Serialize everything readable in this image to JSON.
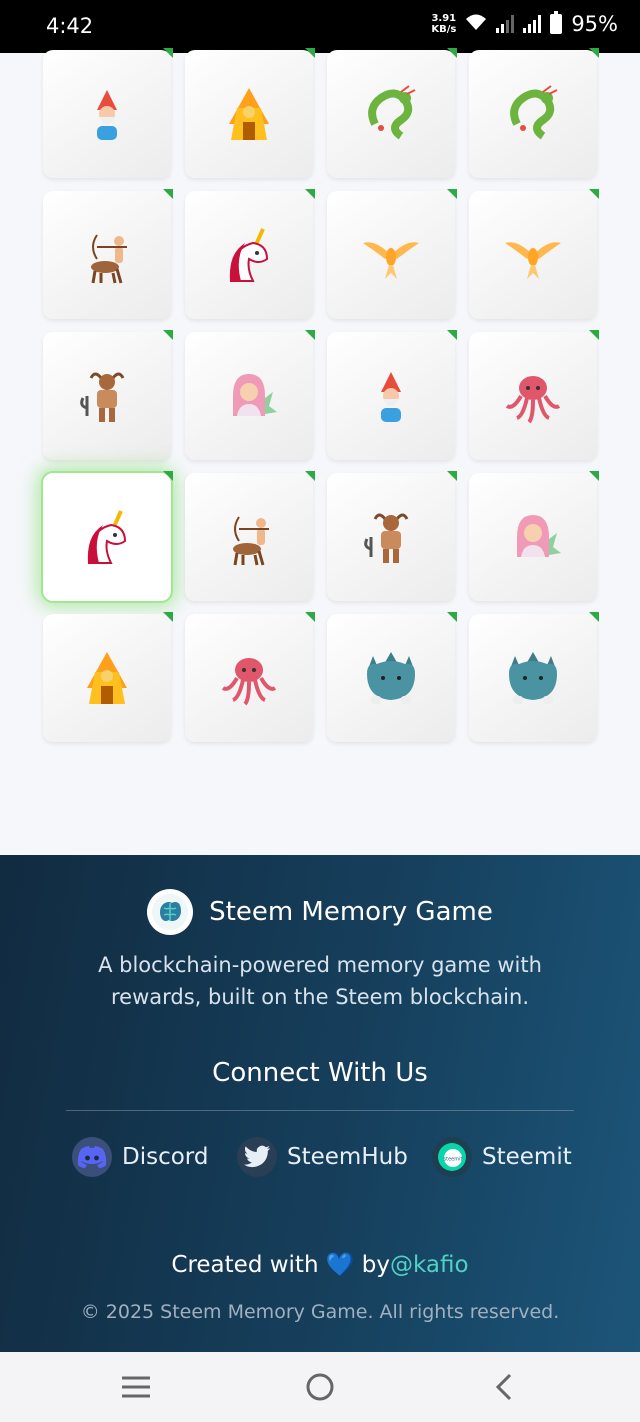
{
  "status_bar": {
    "time": "4:42",
    "net_speed_value": "3.91",
    "net_speed_unit": "KB/s",
    "battery_percent": "95%",
    "icons": [
      "wifi-icon",
      "signal-icon",
      "signal-icon",
      "battery-icon"
    ]
  },
  "game": {
    "columns": 4,
    "rows": 5,
    "cards": [
      {
        "creature": "gnome",
        "matched": true,
        "active": false
      },
      {
        "creature": "sphinx",
        "matched": true,
        "active": false
      },
      {
        "creature": "dragon",
        "matched": true,
        "active": false
      },
      {
        "creature": "dragon",
        "matched": true,
        "active": false
      },
      {
        "creature": "centaur",
        "matched": true,
        "active": false
      },
      {
        "creature": "unicorn",
        "matched": true,
        "active": false
      },
      {
        "creature": "phoenix",
        "matched": true,
        "active": false
      },
      {
        "creature": "phoenix",
        "matched": true,
        "active": false
      },
      {
        "creature": "minotaur",
        "matched": true,
        "active": false
      },
      {
        "creature": "mermaid",
        "matched": true,
        "active": false
      },
      {
        "creature": "gnome",
        "matched": true,
        "active": false
      },
      {
        "creature": "kraken",
        "matched": true,
        "active": false
      },
      {
        "creature": "unicorn",
        "matched": true,
        "active": true
      },
      {
        "creature": "centaur",
        "matched": true,
        "active": false
      },
      {
        "creature": "minotaur",
        "matched": true,
        "active": false
      },
      {
        "creature": "mermaid",
        "matched": true,
        "active": false
      },
      {
        "creature": "sphinx",
        "matched": true,
        "active": false
      },
      {
        "creature": "kraken",
        "matched": true,
        "active": false
      },
      {
        "creature": "cerberus",
        "matched": true,
        "active": false
      },
      {
        "creature": "cerberus",
        "matched": true,
        "active": false
      }
    ]
  },
  "footer": {
    "brand": "Steem Memory Game",
    "tagline": "A blockchain-powered memory game with rewards, built on the Steem blockchain.",
    "connect_title": "Connect With Us",
    "socials": [
      {
        "label": "Discord",
        "icon": "discord-icon",
        "color": "#5865f2"
      },
      {
        "label": "SteemHub",
        "icon": "twitter-bird-icon",
        "color": "#1da1f2"
      },
      {
        "label": "Steemit",
        "icon": "steemit-icon",
        "color": "#06d6a9"
      }
    ],
    "created_prefix": "Created with",
    "created_heart": "💙",
    "created_by": "by",
    "created_handle": "@kafio",
    "copyright": "© 2025 Steem Memory Game. All rights reserved."
  },
  "colors": {
    "accent_teal": "#4fd1c5",
    "match_green": "#2eaa44",
    "footer_dark": "#112b40",
    "footer_light": "#1c5579"
  }
}
